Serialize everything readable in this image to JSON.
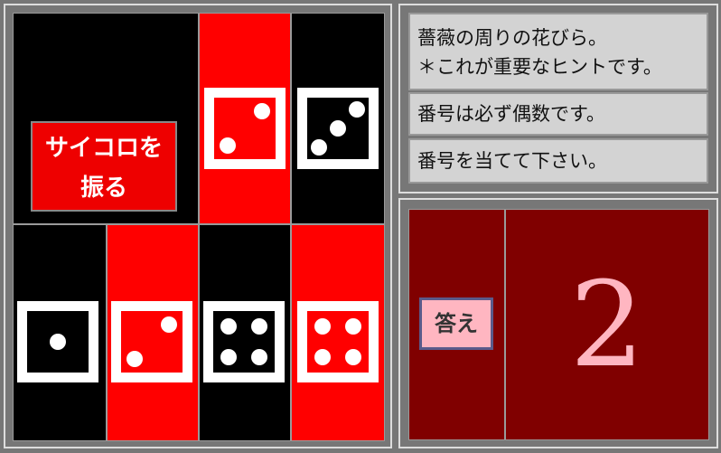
{
  "roll_button": {
    "line1": "サイコロを",
    "line2": "振る"
  },
  "hints": [
    {
      "line1": "薔薇の周りの花びら。",
      "line2": "＊これが重要なヒントです。"
    },
    {
      "line1": "番号は必ず偶数です。"
    },
    {
      "line1": "番号を当てて下さい。"
    }
  ],
  "answer": {
    "button_label": "答え",
    "number": "2"
  },
  "dice": [
    {
      "value": 2,
      "face": "white",
      "pips": "red"
    },
    {
      "value": 3,
      "face": "white",
      "pips": "black"
    },
    {
      "value": 1,
      "face": "white",
      "pips": "black"
    },
    {
      "value": 2,
      "face": "white",
      "pips": "red"
    },
    {
      "value": 4,
      "face": "white",
      "pips": "black"
    },
    {
      "value": 4,
      "face": "white",
      "pips": "red"
    }
  ],
  "colors": {
    "black": "#000000",
    "red": "#ff0000",
    "maroon": "#800000",
    "pink": "#ffb6c1",
    "hint_bg": "#d3d3d3"
  }
}
